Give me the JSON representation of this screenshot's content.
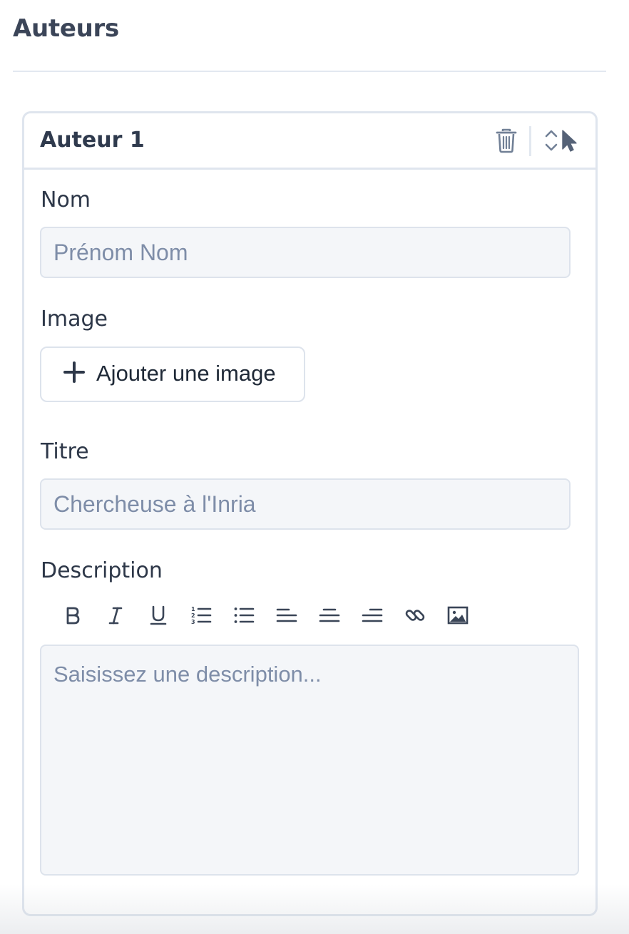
{
  "section": {
    "title": "Auteurs"
  },
  "author_card": {
    "title": "Auteur 1",
    "actions": {
      "delete_icon": "trash-icon",
      "reorder_icon": "chevron-up-down-icon",
      "cursor_icon": "cursor-arrow-icon"
    },
    "name_field": {
      "label": "Nom",
      "value": "",
      "placeholder": "Prénom Nom"
    },
    "image_field": {
      "label": "Image",
      "button_label": "Ajouter une image",
      "button_icon": "plus-icon"
    },
    "title_field": {
      "label": "Titre",
      "value": "",
      "placeholder": "Chercheuse à l'Inria"
    },
    "description_field": {
      "label": "Description",
      "value": "",
      "placeholder": "Saisissez une description...",
      "toolbar": [
        "bold-icon",
        "italic-icon",
        "underline-icon",
        "ordered-list-icon",
        "bullet-list-icon",
        "align-left-icon",
        "align-center-icon",
        "align-right-icon",
        "link-icon",
        "image-icon"
      ]
    }
  },
  "colors": {
    "text_primary": "#2d3748",
    "placeholder": "#7e8da8",
    "border": "#dde3ec",
    "input_background": "#f4f6f9",
    "icon": "#4a5568",
    "muted_icon": "#718096"
  }
}
